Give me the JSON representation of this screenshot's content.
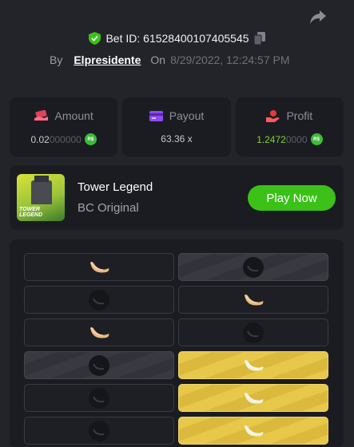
{
  "header": {
    "bet_id": "Bet ID: 61528400107405545",
    "by_label": "By",
    "username": "Elpresidente",
    "on_label": "On",
    "date": "8/29/2022, 12:24:57 PM"
  },
  "stats": {
    "amount": {
      "label": "Amount",
      "value_main": "0.02",
      "value_dim": "000000"
    },
    "payout": {
      "label": "Payout",
      "value": "63.36 x"
    },
    "profit": {
      "label": "Profit",
      "value_main": "1.2472",
      "value_dim": "0000"
    },
    "currency_badge": "R$"
  },
  "game": {
    "thumbnail_text": "TOWER LEGEND",
    "name": "Tower Legend",
    "provider": "BC Original",
    "play_label": "Play Now"
  },
  "board": {
    "rows": [
      [
        "banana",
        "skull-grey"
      ],
      [
        "skull-dark",
        "banana"
      ],
      [
        "banana",
        "skull-dark"
      ],
      [
        "skull-grey",
        "banana-gold"
      ],
      [
        "skull-dark",
        "banana-gold"
      ],
      [
        "skull-dark",
        "banana-gold"
      ]
    ]
  },
  "colors": {
    "background": "#232429",
    "panel": "#1b1c21",
    "play_button": "#3bc117",
    "profit_green": "#7bd42e",
    "gold_tile": "#e8c84b",
    "banana": "#e9b77f"
  },
  "icons": {
    "share": "share-arrow-icon",
    "verified": "shield-check-icon",
    "copy": "copy-icon",
    "amount": "money-icon",
    "payout": "card-icon",
    "profit": "profit-hand-icon",
    "safe": "banana-icon",
    "mine": "skull-icon"
  }
}
